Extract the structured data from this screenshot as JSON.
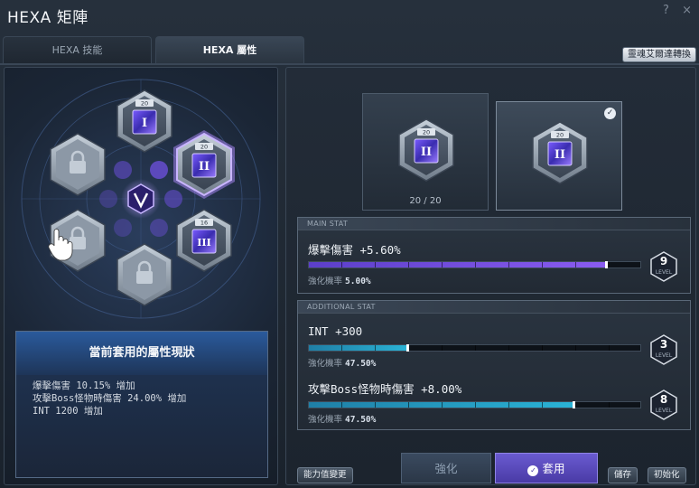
{
  "window": {
    "title": "HEXA 矩陣",
    "help_icon": "?",
    "close_icon": "×"
  },
  "tabs": [
    {
      "label": "HEXA 技能",
      "active": false
    },
    {
      "label": "HEXA 屬性",
      "active": true
    }
  ],
  "top_button": "靈魂艾爾達轉換",
  "hex_grid": {
    "nodes": [
      {
        "slot": "top",
        "level": "20",
        "numeral": "I",
        "locked": false
      },
      {
        "slot": "upper-right",
        "level": "20",
        "numeral": "II",
        "locked": false,
        "selected": true
      },
      {
        "slot": "lower-right",
        "level": "16",
        "numeral": "III",
        "locked": false
      },
      {
        "slot": "bottom",
        "locked": true
      },
      {
        "slot": "lower-left",
        "locked": true
      },
      {
        "slot": "upper-left",
        "locked": true
      }
    ],
    "center_icon": "v-emblem-icon"
  },
  "status_panel": {
    "title": "當前套用的屬性現狀",
    "lines": [
      "爆擊傷害 10.15% 增加",
      "攻擊Boss怪物時傷害 24.00% 增加",
      "INT 1200 增加"
    ]
  },
  "core_cards": [
    {
      "level": "20",
      "numeral": "II",
      "count": "20 / 20",
      "selected": false
    },
    {
      "level": "20",
      "numeral": "II",
      "selected": true
    }
  ],
  "main_stat": {
    "header": "MAIN STAT",
    "name": "爆擊傷害 +5.60%",
    "prob_label": "強化機率",
    "prob_value": "5.00%",
    "level": "9",
    "level_label": "LEVEL",
    "fill": 0.9,
    "color": "#8a5cf0"
  },
  "additional_stat": {
    "header": "ADDITIONAL STAT",
    "stats": [
      {
        "name": "INT +300",
        "prob_label": "強化機率",
        "prob_value": "47.50%",
        "level": "3",
        "level_label": "LEVEL",
        "fill": 0.3
      },
      {
        "name": "攻擊Boss怪物時傷害 +8.00%",
        "prob_label": "強化機率",
        "prob_value": "47.50%",
        "level": "8",
        "level_label": "LEVEL",
        "fill": 0.8
      }
    ],
    "color": "#2ab3d6"
  },
  "buttons": {
    "ability_change": "能力值變更",
    "enhance": "強化",
    "apply": "套用",
    "save": "儲存",
    "reset": "初始化"
  },
  "colors": {
    "accent_purple": "#7b5ce6",
    "accent_cyan": "#2ab3d6",
    "hex_silver": "#9aa7b6"
  }
}
